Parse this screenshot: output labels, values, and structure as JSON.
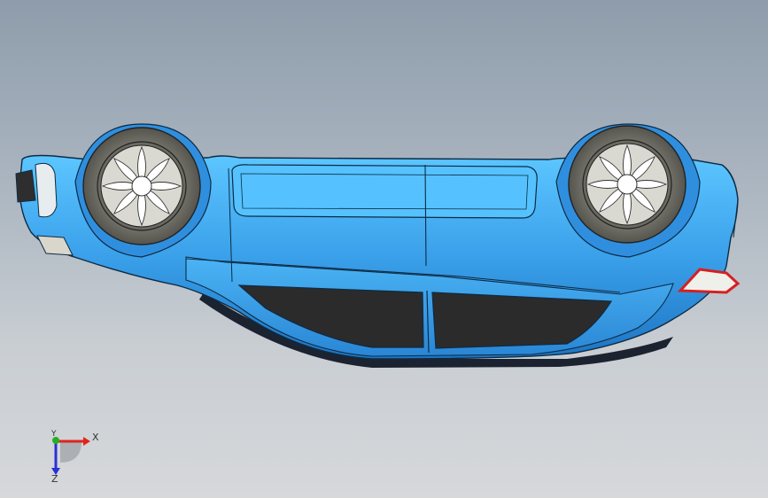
{
  "viewport": {
    "background_top": "#8e9cab",
    "background_bottom": "#d6d8da"
  },
  "model": {
    "body_color": "#3aa0ea",
    "body_highlight": "#6fd0ff",
    "window_color": "#2b2b2b",
    "tire_color": "#6b6b63",
    "rim_color": "#d9d9d2",
    "taillight_color": "#d62020"
  },
  "triad": {
    "x_label": "X",
    "y_label": "Y",
    "z_label": "Z",
    "x_color": "#e0241b",
    "y_color": "#22b122",
    "z_color": "#2b2fd6"
  }
}
